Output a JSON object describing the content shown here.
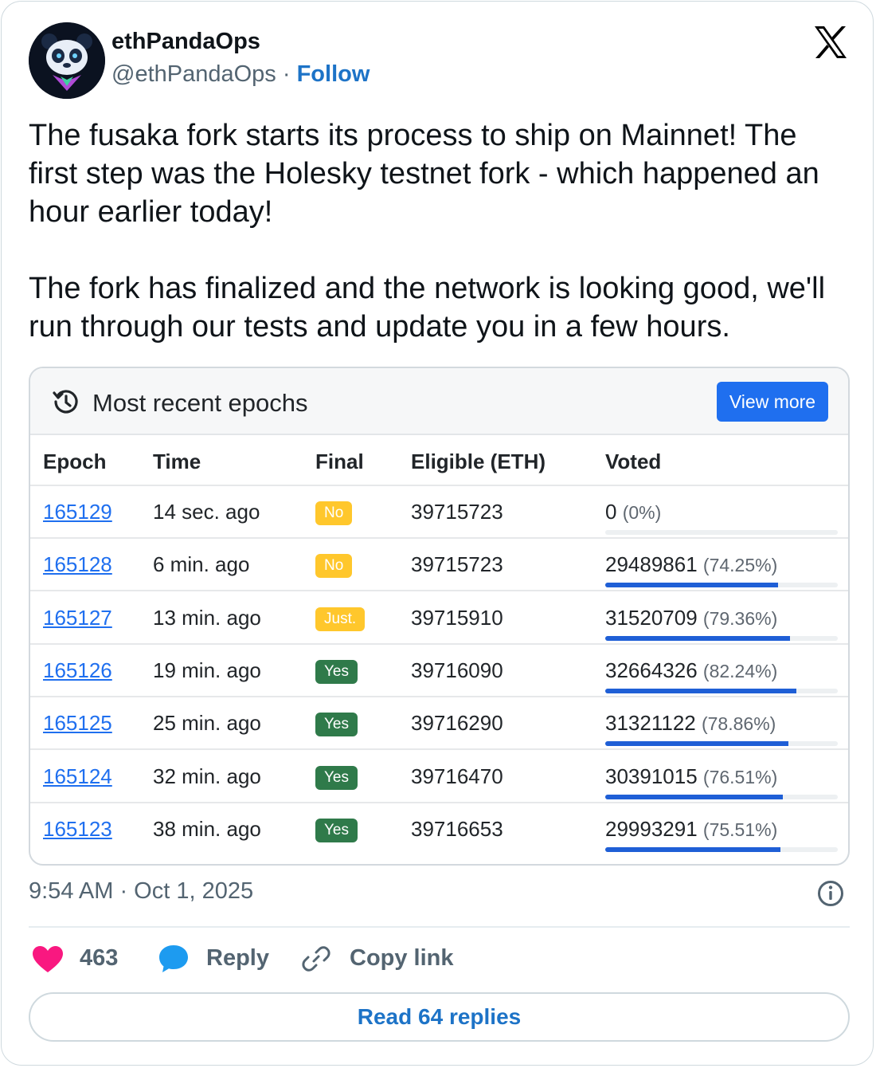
{
  "author": {
    "name": "ethPandaOps",
    "handle": "@ethPandaOps",
    "separator": "·",
    "follow": "Follow"
  },
  "tweet": {
    "text": "The fusaka fork starts its process to ship on Mainnet! The first step was the Holesky testnet fork - which happened an hour earlier today!\n\nThe fork has finalized and the network is looking good, we'll run through our tests and update you in a few hours."
  },
  "media": {
    "title": "Most recent epochs",
    "view_more": "View more",
    "columns": [
      "Epoch",
      "Time",
      "Final",
      "Eligible (ETH)",
      "Voted"
    ],
    "rows": [
      {
        "epoch": "165129",
        "time": "14 sec. ago",
        "final": "No",
        "final_status": "warn",
        "eligible": "39715723",
        "voted": "0",
        "pct": "(0%)",
        "pct_value": 0
      },
      {
        "epoch": "165128",
        "time": "6 min. ago",
        "final": "No",
        "final_status": "warn",
        "eligible": "39715723",
        "voted": "29489861",
        "pct": "(74.25%)",
        "pct_value": 74.25
      },
      {
        "epoch": "165127",
        "time": "13 min. ago",
        "final": "Just.",
        "final_status": "warn",
        "eligible": "39715910",
        "voted": "31520709",
        "pct": "(79.36%)",
        "pct_value": 79.36
      },
      {
        "epoch": "165126",
        "time": "19 min. ago",
        "final": "Yes",
        "final_status": "ok",
        "eligible": "39716090",
        "voted": "32664326",
        "pct": "(82.24%)",
        "pct_value": 82.24
      },
      {
        "epoch": "165125",
        "time": "25 min. ago",
        "final": "Yes",
        "final_status": "ok",
        "eligible": "39716290",
        "voted": "31321122",
        "pct": "(78.86%)",
        "pct_value": 78.86
      },
      {
        "epoch": "165124",
        "time": "32 min. ago",
        "final": "Yes",
        "final_status": "ok",
        "eligible": "39716470",
        "voted": "30391015",
        "pct": "(76.51%)",
        "pct_value": 76.51
      },
      {
        "epoch": "165123",
        "time": "38 min. ago",
        "final": "Yes",
        "final_status": "ok",
        "eligible": "39716653",
        "voted": "29993291",
        "pct": "(75.51%)",
        "pct_value": 75.51
      }
    ]
  },
  "meta": {
    "timestamp": "9:54 AM · Oct 1, 2025"
  },
  "actions": {
    "likes": "463",
    "reply": "Reply",
    "copy_link": "Copy link",
    "read_replies": "Read 64 replies"
  },
  "icons": [
    "x-logo-icon",
    "history-icon",
    "info-icon",
    "heart-icon",
    "reply-bubble-icon",
    "link-icon"
  ],
  "colors": {
    "follow": "#1d73c7",
    "heart": "#f91880",
    "bubble": "#1d9bf0",
    "button": "#1f6fef",
    "yes_badge": "#2f7a4a",
    "warn_badge": "#ffc72c",
    "bar": "#1f5fd6"
  }
}
